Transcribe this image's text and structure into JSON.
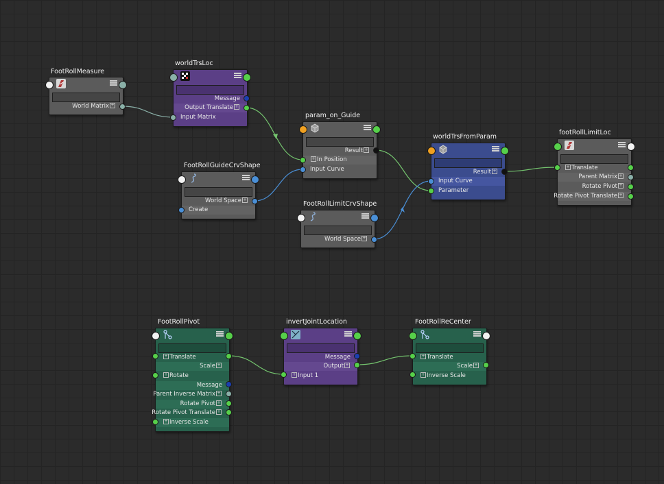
{
  "colors": {
    "background": "#2b2b2b",
    "grey_node": "#5b5b5b",
    "purple_node": "#5b3f86",
    "blue_node": "#3b4c8e",
    "green_node": "#27614c",
    "wire": "#74c46e",
    "wire_blue": "#4a8fd6",
    "wire_grey": "#8ab0a8"
  },
  "nodes": {
    "foot_roll_measure": {
      "title": "FootRollMeasure",
      "icon": "measure-icon",
      "attrs": [
        "World Matrix"
      ]
    },
    "world_trs_loc": {
      "title": "worldTrsLoc",
      "icon": "checker-icon",
      "attrs": [
        "Message",
        "Output Translate",
        "Input Matrix"
      ]
    },
    "param_on_guide": {
      "title": "param_on_Guide",
      "icon": "cube-icon",
      "attrs": [
        "Result",
        "In Position",
        "Input Curve"
      ]
    },
    "world_trs_from_param": {
      "title": "worldTrsFromParam",
      "icon": "cube-icon",
      "attrs": [
        "Result",
        "Input Curve",
        "Parameter"
      ]
    },
    "foot_roll_limit_loc": {
      "title": "footRollLimitLoc",
      "icon": "locator-icon",
      "attrs": [
        "Translate",
        "Parent Matrix",
        "Rotate Pivot",
        "Rotate Pivot Translate"
      ]
    },
    "foot_roll_guide_crv_shape": {
      "title": "FootRollGuideCrvShape",
      "icon": "curve-icon",
      "attrs": [
        "World Space",
        "Create"
      ]
    },
    "foot_roll_limit_crv_shape": {
      "title": "FootRollLimitCrvShape",
      "icon": "curve-icon",
      "attrs": [
        "World Space"
      ]
    },
    "foot_roll_pivot": {
      "title": "FootRollPivot",
      "icon": "joint-icon",
      "attrs": [
        "Translate",
        "Scale",
        "Rotate",
        "Message",
        "Parent Inverse Matrix",
        "Rotate Pivot",
        "Rotate Pivot Translate",
        "Inverse Scale"
      ]
    },
    "invert_joint_location": {
      "title": "invertJointLocation",
      "icon": "reverse-icon",
      "attrs": [
        "Message",
        "Output",
        "Input 1"
      ]
    },
    "foot_roll_re_center": {
      "title": "FootRollReCenter",
      "icon": "joint-icon",
      "attrs": [
        "Translate",
        "Scale",
        "Inverse Scale"
      ]
    }
  }
}
